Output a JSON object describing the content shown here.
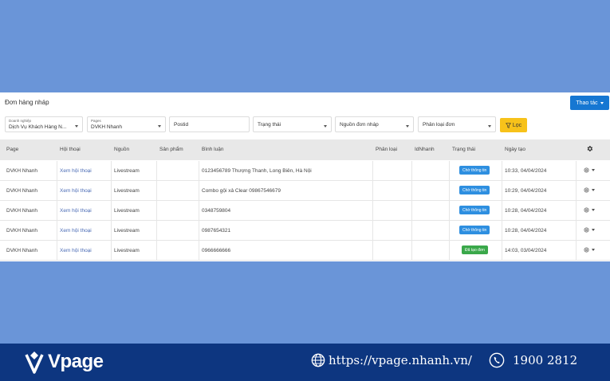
{
  "header": {
    "title": "Đơn hàng nháp",
    "action_label": "Thao tác"
  },
  "filters": {
    "business_label": "Doanh nghiệp",
    "business_value": "Dịch Vụ Khách Hàng N...",
    "pages_label": "Pages",
    "pages_value": "DVKH Nhanh",
    "postid_placeholder": "Postid",
    "status_placeholder": "Trạng thái",
    "source_placeholder": "Nguồn đơn nháp",
    "category_placeholder": "Phân loại đơn",
    "filter_label": "Lọc"
  },
  "table": {
    "headers": {
      "page": "Page",
      "conversation": "Hội thoại",
      "source": "Nguồn",
      "product": "Sản phẩm",
      "comment": "Bình luận",
      "category": "Phân loại",
      "idnhanh": "IdNhanh",
      "status": "Trạng thái",
      "created": "Ngày tạo"
    },
    "rows": [
      {
        "page": "DVKH Nhanh",
        "conversation": "Xem hội thoại",
        "source": "Livestream",
        "comment": "0123456789 Thượng Thanh, Long Biên, Hà Nội",
        "status": "Chờ thông tin",
        "created": "10:33, 04/04/2024"
      },
      {
        "page": "DVKH Nhanh",
        "conversation": "Xem hội thoại",
        "source": "Livestream",
        "comment": "Combo gội xả Clear 09867546679",
        "status": "Chờ thông tin",
        "created": "10:29, 04/04/2024"
      },
      {
        "page": "DVKH Nhanh",
        "conversation": "Xem hội thoại",
        "source": "Livestream",
        "comment": "0348759804",
        "status": "Chờ thông tin",
        "created": "10:28, 04/04/2024"
      },
      {
        "page": "DVKH Nhanh",
        "conversation": "Xem hội thoại",
        "source": "Livestream",
        "comment": "0987654321",
        "status": "Chờ thông tin",
        "created": "10:28, 04/04/2024"
      },
      {
        "page": "DVKH Nhanh",
        "conversation": "Xem hội thoại",
        "source": "Livestream",
        "comment": "0966666666",
        "status": "Đã tạo đơn",
        "created": "14:03, 03/04/2024"
      }
    ]
  },
  "footer": {
    "brand": "Vpage",
    "url": "https://vpage.nhanh.vn/",
    "phone": "1900 2812"
  },
  "colors": {
    "background": "#6a95d8",
    "accent": "#1677d2",
    "filter_button": "#f7c21a",
    "status_waiting": "#2e8fe0",
    "status_created": "#3aa84a",
    "footer": "#0d3680"
  }
}
